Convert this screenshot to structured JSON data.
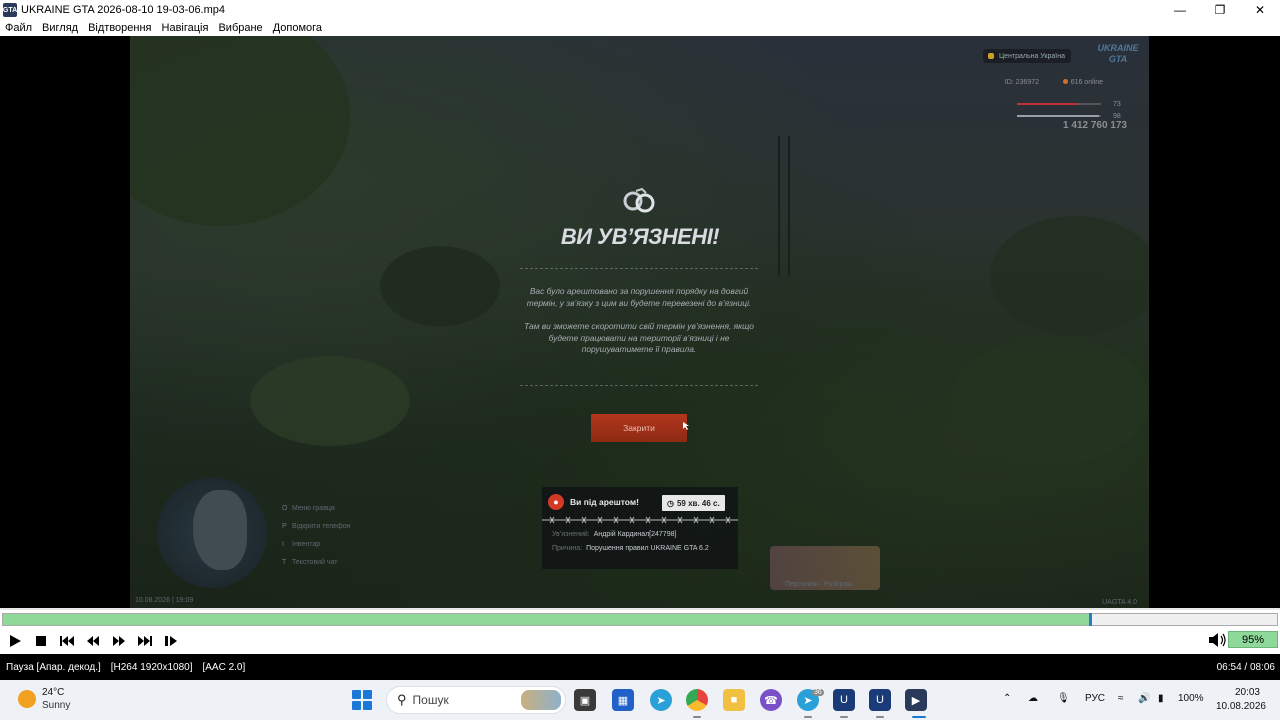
{
  "window": {
    "title": "UKRAINE GTA 2026-08-10 19-03-06.mp4",
    "icon_text": "GTA"
  },
  "menu": [
    "Файл",
    "Вигляд",
    "Відтворення",
    "Навігація",
    "Вибране",
    "Допомога"
  ],
  "game": {
    "region": "Центральна Україна",
    "logo": "UKRAINE GTA",
    "player_id": "ID: 236972",
    "online": "616 online",
    "health": "73",
    "health_fraction": 0.73,
    "armor": "98",
    "armor_fraction": 0.98,
    "money": "1 412 760 173",
    "modal": {
      "title": "ВИ УВ’ЯЗНЕНІ!",
      "para1": "Вас було арештовано за порушення порядку на довгий термін, у зв’язку з цим ви будете перевезені до в’язниці.",
      "para2": "Там ви зможете скоротити свій термін ув’язнення, якщо будете працювати на території в’язниці і не порушуватимете її правила.",
      "close_label": "Закрити"
    },
    "notification": {
      "title": "Ви під арештом!",
      "timer": "59 хв. 46 с.",
      "prisoner_label": "Ув’язнений:",
      "prisoner_value": "Андрій Кардинал[247798]",
      "reason_label": "Причина:",
      "reason_value": "Порушення правил UKRAINE GTA 6.2"
    },
    "hints": [
      {
        "key": "O",
        "label": "Меню гравця"
      },
      {
        "key": "P",
        "label": "Відкрити телефон"
      },
      {
        "key": "I",
        "label": "Інвентар"
      },
      {
        "key": "T",
        "label": "Текстовий чат"
      }
    ],
    "datestamp": "10.08.2026 | 19:09",
    "promo_label": "Персонаж · Розіграш",
    "version": "UAGTA 4.0"
  },
  "player": {
    "progress_fraction": 0.853,
    "volume": "95%",
    "status_state": "Пауза [Апар. декод.]",
    "status_video": "[H264 1920x1080]",
    "status_audio": "[AAC 2.0]",
    "status_time": "06:54 / 08:06"
  },
  "taskbar": {
    "weather_temp": "24°C",
    "weather_desc": "Sunny",
    "search_placeholder": "Пошук",
    "lang": "РУС",
    "battery": "100%",
    "time": "20:03",
    "date": "10.08.2026",
    "telegram_badge": "36"
  },
  "colors": {
    "seek_fill": "#8ed89a",
    "seek_thumb": "#2a7ad0",
    "close_button": "#b2361c",
    "arrest_icon": "#d23a26"
  }
}
